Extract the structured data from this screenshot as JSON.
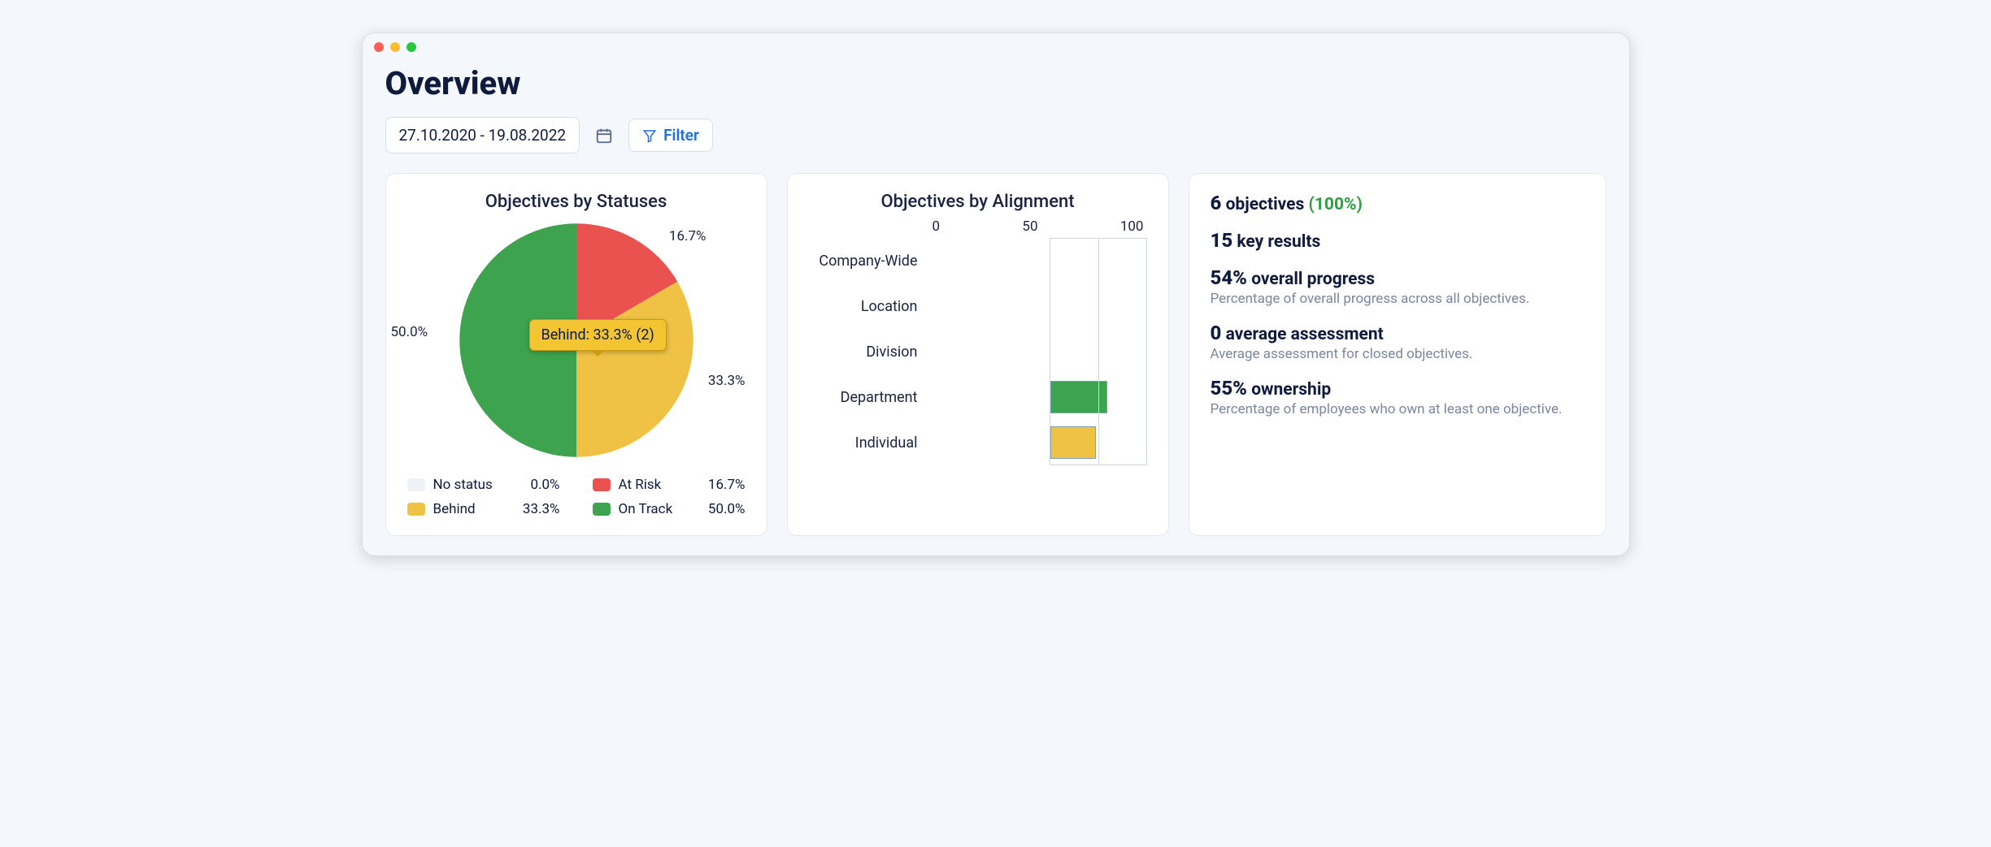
{
  "page": {
    "title": "Overview"
  },
  "controls": {
    "date_range": "27.10.2020 - 19.08.2022",
    "filter_label": "Filter"
  },
  "pie": {
    "title": "Objectives by Statuses",
    "label_top_right": "16.7%",
    "label_right": "33.3%",
    "label_left": "50.0%",
    "tooltip": "Behind: 33.3% (2)",
    "colors": {
      "no_status": "#eef1f6",
      "at_risk": "#e9524f",
      "behind": "#efc246",
      "on_track": "#3da34f"
    },
    "legend": [
      {
        "label": "No status",
        "pct": "0.0%",
        "color": "#eef1f6"
      },
      {
        "label": "At Risk",
        "pct": "16.7%",
        "color": "#e9524f"
      },
      {
        "label": "Behind",
        "pct": "33.3%",
        "color": "#efc246"
      },
      {
        "label": "On Track",
        "pct": "50.0%",
        "color": "#3da34f"
      }
    ]
  },
  "bar": {
    "title": "Objectives by Alignment",
    "ticks": [
      "0",
      "50",
      "100"
    ],
    "rows": [
      {
        "label": "Company-Wide",
        "value": 0,
        "color": ""
      },
      {
        "label": "Location",
        "value": 0,
        "color": ""
      },
      {
        "label": "Division",
        "value": 0,
        "color": ""
      },
      {
        "label": "Department",
        "value": 60,
        "color": "#3da34f"
      },
      {
        "label": "Individual",
        "value": 48,
        "color": "#efc246"
      }
    ]
  },
  "stats": {
    "objectives_n": "6",
    "objectives_label": "objectives",
    "objectives_pct": "(100%)",
    "kr_n": "15",
    "kr_label": "key results",
    "progress_n": "54%",
    "progress_label": "overall progress",
    "progress_sub": "Percentage of overall progress across all objectives.",
    "assess_n": "0",
    "assess_label": "average assessment",
    "assess_sub": "Average assessment for closed objectives.",
    "own_n": "55%",
    "own_label": "ownership",
    "own_sub": "Percentage of employees who own at least one objective."
  },
  "chart_data": [
    {
      "type": "pie",
      "title": "Objectives by Statuses",
      "series": [
        {
          "name": "No status",
          "value": 0.0
        },
        {
          "name": "At Risk",
          "value": 16.7
        },
        {
          "name": "Behind",
          "value": 33.3
        },
        {
          "name": "On Track",
          "value": 50.0
        }
      ],
      "annotations": [
        "Behind: 33.3% (2)"
      ]
    },
    {
      "type": "bar",
      "orientation": "horizontal",
      "title": "Objectives by Alignment",
      "xlabel": "",
      "ylabel": "",
      "xlim": [
        0,
        100
      ],
      "categories": [
        "Company-Wide",
        "Location",
        "Division",
        "Department",
        "Individual"
      ],
      "values": [
        0,
        0,
        0,
        60,
        48
      ]
    }
  ]
}
